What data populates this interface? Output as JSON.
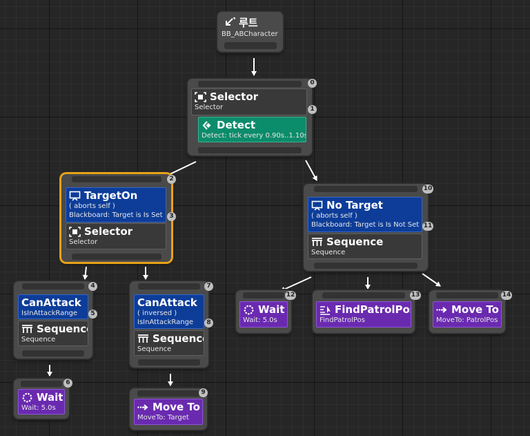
{
  "root": {
    "title": "루트",
    "blackboard": "BB_ABCharacter"
  },
  "nodes": {
    "selector_main": {
      "index": "0",
      "title": "Selector",
      "subtitle": "Selector",
      "service": {
        "index": "1",
        "title": "Detect",
        "subtitle": "Detect: tick every 0.90s..1.10s"
      }
    },
    "targeton": {
      "index": "2",
      "title": "TargetOn",
      "line1": "( aborts self )",
      "line2": "Blackboard: Target is Is Set",
      "child_index": "3",
      "child_title": "Selector",
      "child_subtitle": "Selector"
    },
    "notarget": {
      "index": "10",
      "title": "No Target",
      "line1": "( aborts self )",
      "line2": "Blackboard: Target is Is Not Set",
      "child_index": "11",
      "child_title": "Sequence",
      "child_subtitle": "Sequence"
    },
    "canattack_a": {
      "index": "4",
      "title": "CanAttack",
      "line1": "IsInAttackRange",
      "child_index": "5",
      "child_title": "Sequence",
      "child_subtitle": "Sequence"
    },
    "canattack_b": {
      "index": "7",
      "title": "CanAttack",
      "line1": "( inversed )",
      "line2": "IsInAttackRange",
      "child_index": "8",
      "child_title": "Sequence",
      "child_subtitle": "Sequence"
    },
    "wait_a": {
      "index": "6",
      "title": "Wait",
      "subtitle": "Wait: 5.0s"
    },
    "moveto_a": {
      "index": "9",
      "title": "Move To",
      "subtitle": "MoveTo: Target"
    },
    "wait_b": {
      "index": "12",
      "title": "Wait",
      "subtitle": "Wait: 5.0s"
    },
    "findpatrol": {
      "index": "13",
      "title": "FindPatrolPos",
      "subtitle": "FindPatrolPos"
    },
    "moveto_b": {
      "index": "14",
      "title": "Move To",
      "subtitle": "MoveTo: PatrolPos"
    }
  },
  "colors": {
    "decorator": "#0d3d99",
    "composite": "#393939",
    "service": "#0b8c6b",
    "task": "#6a2ab0",
    "selection": "#e8a218"
  },
  "icons": {
    "root": "root-arrow-icon",
    "selector": "selector-icon",
    "service": "service-icon",
    "decorator": "blackboard-decorator-icon",
    "sequence": "sequence-icon",
    "wait": "wait-icon",
    "moveto": "move-to-icon",
    "findpatrol": "find-patrol-icon"
  }
}
